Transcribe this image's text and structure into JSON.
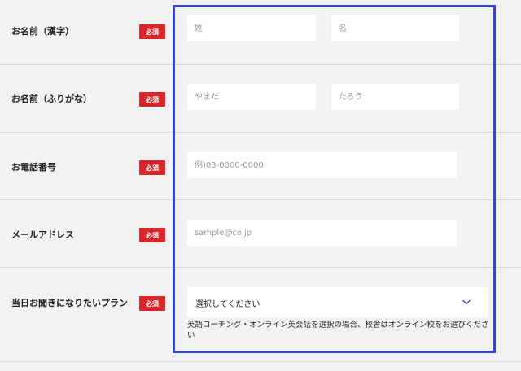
{
  "form": {
    "required_label": "必須",
    "name_kanji": {
      "label": "お名前（漢字）",
      "last_placeholder": "姓",
      "first_placeholder": "名"
    },
    "name_kana": {
      "label": "お名前（ふりがな）",
      "last_placeholder": "やまだ",
      "first_placeholder": "たろう"
    },
    "phone": {
      "label": "お電話番号",
      "placeholder": "例)03-0000-0000"
    },
    "email": {
      "label": "メールアドレス",
      "placeholder": "sample@co.jp"
    },
    "plan": {
      "label": "当日お聞きになりたいプラン",
      "selected": "選択してください",
      "note": "英語コーチング・オンライン英会話を選択の場合、校舎はオンライン校をお選びください"
    }
  },
  "colors": {
    "page_background": "#f2f2f2",
    "required_badge": "#d9262a",
    "highlight_border": "#3a46c8"
  },
  "icons": {
    "select_arrow": "chevron-down-icon"
  }
}
